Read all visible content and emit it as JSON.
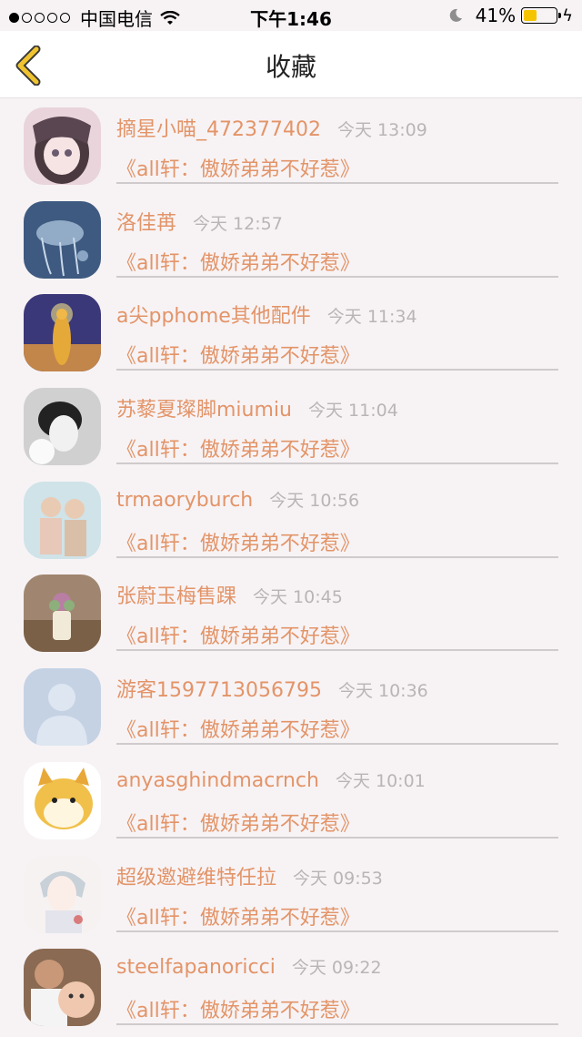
{
  "status_bar": {
    "carrier": "中国电信",
    "time": "下午1:46",
    "battery": "41%",
    "battery_level": 0.41,
    "icons": [
      "signal-dots-icon",
      "wifi-icon",
      "moon-icon",
      "battery-icon",
      "charging-bolt-icon"
    ]
  },
  "nav": {
    "title": "收藏",
    "back_icon": "chevron-left-icon",
    "accent_color": "#f0c430"
  },
  "colors": {
    "accent_text": "#e39468",
    "time_text": "#b9b4b6",
    "background": "#f7f3f5"
  },
  "items": [
    {
      "username": "摘星小喵_472377402",
      "time": "今天 13:09",
      "book": "《all轩：傲娇弟弟不好惹》",
      "avatar": "anime-girl"
    },
    {
      "username": "洛佳苒",
      "time": "今天 12:57",
      "book": "《all轩：傲娇弟弟不好惹》",
      "avatar": "underwater-jellyfish"
    },
    {
      "username": "a尖pphome其他配件",
      "time": "今天 11:34",
      "book": "《all轩：傲娇弟弟不好惹》",
      "avatar": "golden-buddha"
    },
    {
      "username": "苏藜夏璨脚miumiu",
      "time": "今天 11:04",
      "book": "《all轩：傲娇弟弟不好惹》",
      "avatar": "bw-portrait"
    },
    {
      "username": "trmaoryburch",
      "time": "今天 10:56",
      "book": "《all轩：傲娇弟弟不好惹》",
      "avatar": "two-children"
    },
    {
      "username": "张蔚玉梅售踝",
      "time": "今天 10:45",
      "book": "《all轩：傲娇弟弟不好惹》",
      "avatar": "succulent-pot"
    },
    {
      "username": "游客1597713056795",
      "time": "今天 10:36",
      "book": "《all轩：傲娇弟弟不好惹》",
      "avatar": "default-person"
    },
    {
      "username": "anyasghindmacrnch",
      "time": "今天 10:01",
      "book": "《all轩：傲娇弟弟不好惹》",
      "avatar": "cartoon-dog"
    },
    {
      "username": "超级邀避维特任拉",
      "time": "今天 09:53",
      "book": "《all轩：傲娇弟弟不好惹》",
      "avatar": "anime-boy"
    },
    {
      "username": "steelfapanoricci",
      "time": "今天 09:22",
      "book": "《all轩：傲娇弟弟不好惹》",
      "avatar": "man-and-baby"
    }
  ]
}
